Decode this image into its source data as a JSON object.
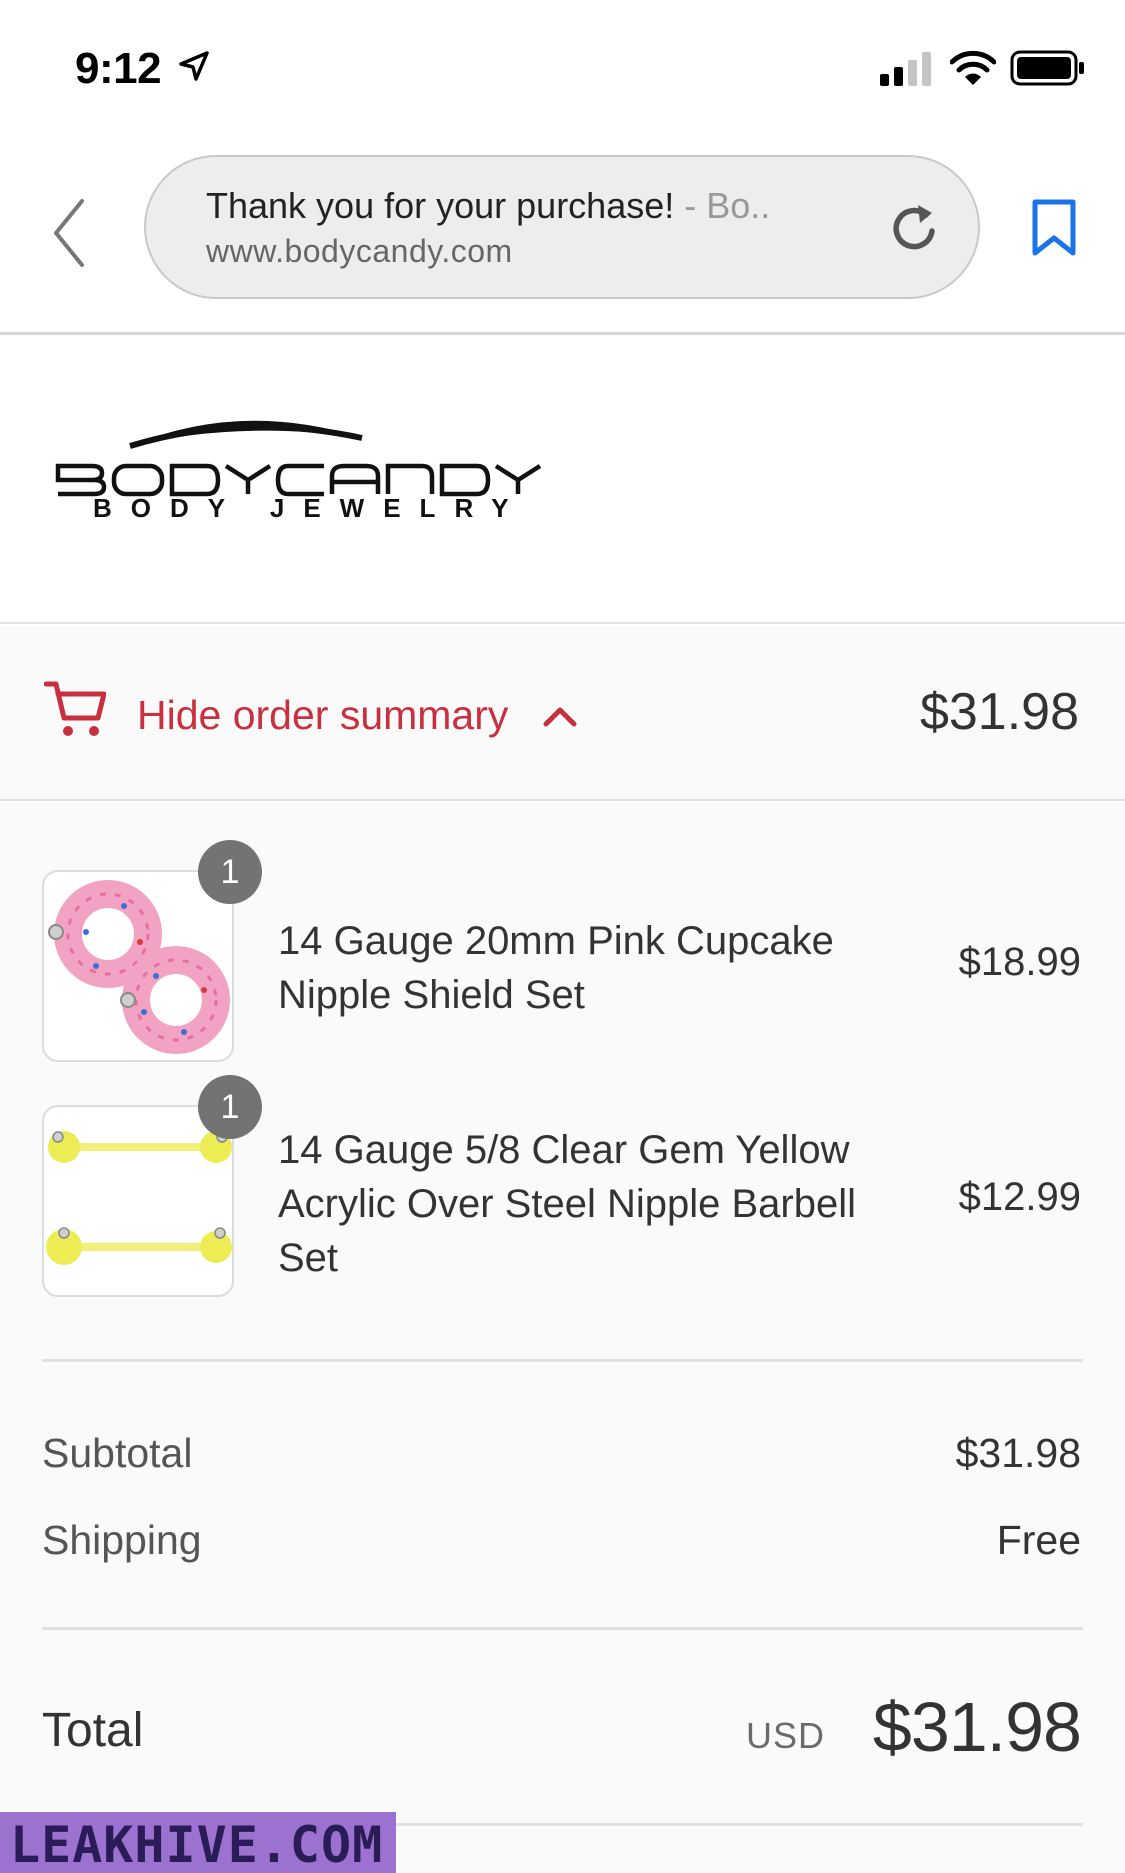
{
  "status_bar": {
    "time": "9:12",
    "location_icon": "location-arrow-icon",
    "signal_icon": "cellular-signal-icon",
    "wifi_icon": "wifi-icon",
    "battery_icon": "battery-icon"
  },
  "browser": {
    "page_title": "Thank you for your purchase!",
    "page_title_tail": " - Bo..",
    "url": "www.bodycandy.com",
    "back_icon": "chevron-left-icon",
    "reload_icon": "reload-icon",
    "bookmark_icon": "bookmark-icon"
  },
  "brand": {
    "logo_name": "BODY CANDY",
    "logo_tagline": "BODY JEWELRY"
  },
  "summary_toggle": {
    "label": "Hide order summary",
    "total": "$31.98",
    "accent_color": "#c8303f"
  },
  "items": [
    {
      "quantity": "1",
      "name": "14 Gauge 20mm Pink Cupcake Nipple Shield Set",
      "price": "$18.99"
    },
    {
      "quantity": "1",
      "name": "14 Gauge 5/8 Clear Gem Yellow Acrylic Over Steel Nipple Barbell Set",
      "price": "$12.99"
    }
  ],
  "totals": {
    "subtotal_label": "Subtotal",
    "subtotal_value": "$31.98",
    "shipping_label": "Shipping",
    "shipping_value": "Free",
    "total_label": "Total",
    "currency": "USD",
    "total_value": "$31.98"
  },
  "watermark": "LEAKHIVE.COM"
}
